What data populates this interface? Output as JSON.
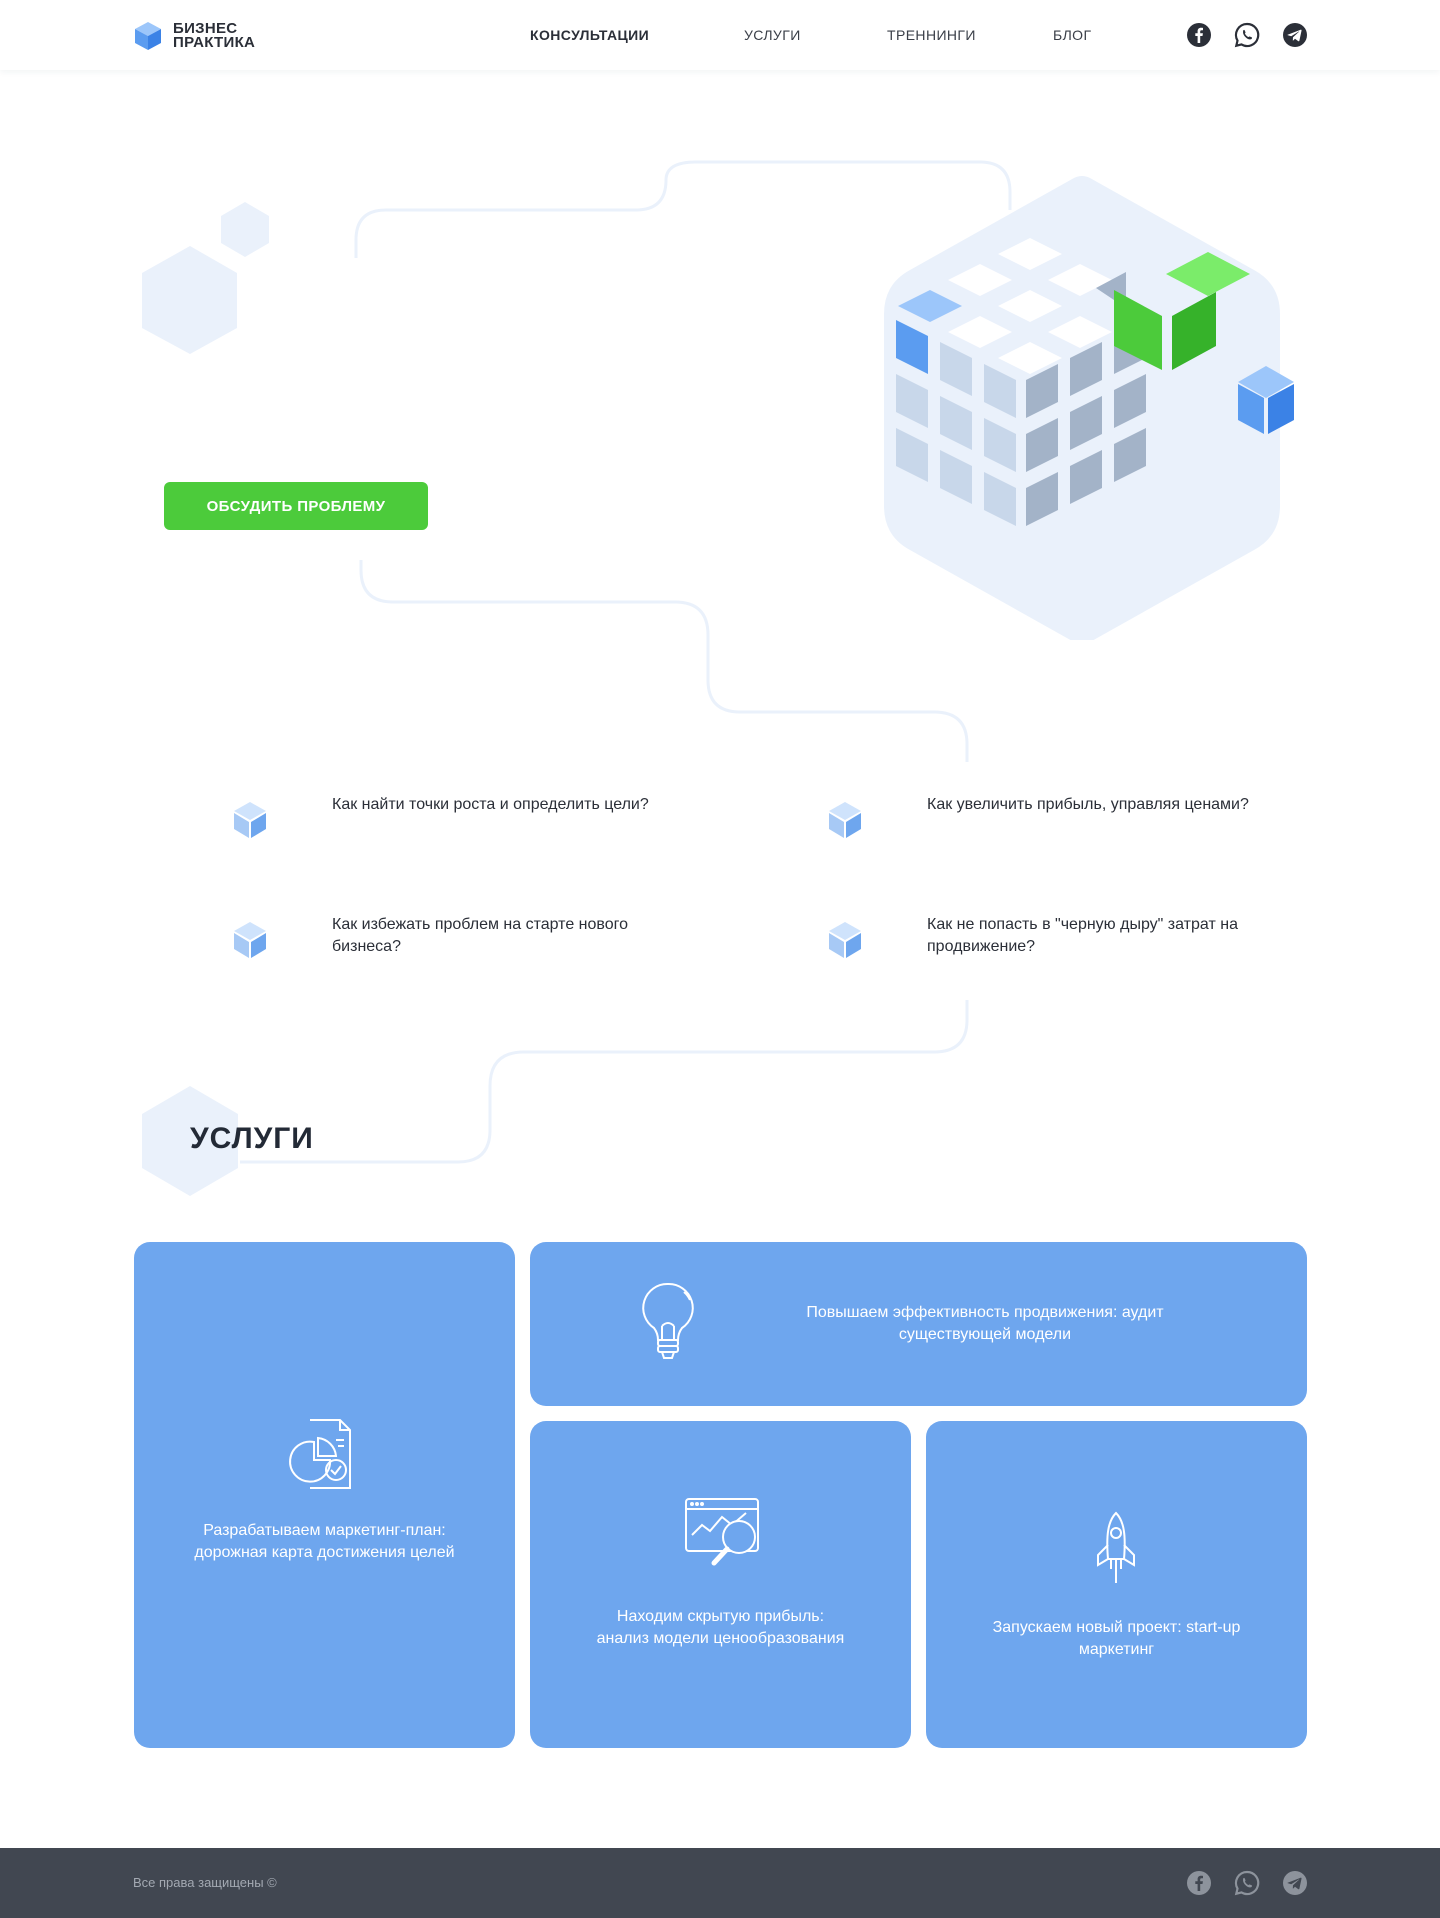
{
  "header": {
    "logo_line1": "БИЗНЕС",
    "logo_line2": "ПРАКТИКА",
    "nav": [
      {
        "label": "КОНСУЛЬТАЦИИ"
      },
      {
        "label": "УСЛУГИ"
      },
      {
        "label": "ТРЕННИНГИ"
      },
      {
        "label": "БЛОГ"
      }
    ],
    "social_icons": [
      "facebook-icon",
      "whatsapp-icon",
      "telegram-icon"
    ]
  },
  "hero": {
    "cta_label": "ОБСУДИТЬ ПРОБЛЕМУ"
  },
  "questions": [
    {
      "text": "Как найти точки роста и определить цели?"
    },
    {
      "text": "Как увеличить прибыль, управляя ценами?"
    },
    {
      "text": "Как избежать проблем на старте нового бизнеса?"
    },
    {
      "text": "Как не попасть в \"черную дыру\" затрат на продвижение?"
    }
  ],
  "services": {
    "title": "УСЛУГИ",
    "cards": [
      {
        "text": "Разрабатываем маркетинг-план: дорожная карта достижения целей",
        "icon": "report-chart-icon"
      },
      {
        "text": "Повышаем эффективность продвижения: аудит существующей модели",
        "icon": "lightbulb-icon"
      },
      {
        "text": "Находим скрытую прибыль: анализ модели ценообразования",
        "icon": "analytics-search-icon"
      },
      {
        "text": "Запускаем новый проект: start-up маркетинг",
        "icon": "rocket-icon"
      }
    ]
  },
  "footer": {
    "copyright": "Все права защищены ©"
  },
  "colors": {
    "accent_green": "#4ccb3b",
    "card_blue": "#6ea6ee",
    "footer_bg": "#414751",
    "line_light": "#eaf1fb"
  }
}
